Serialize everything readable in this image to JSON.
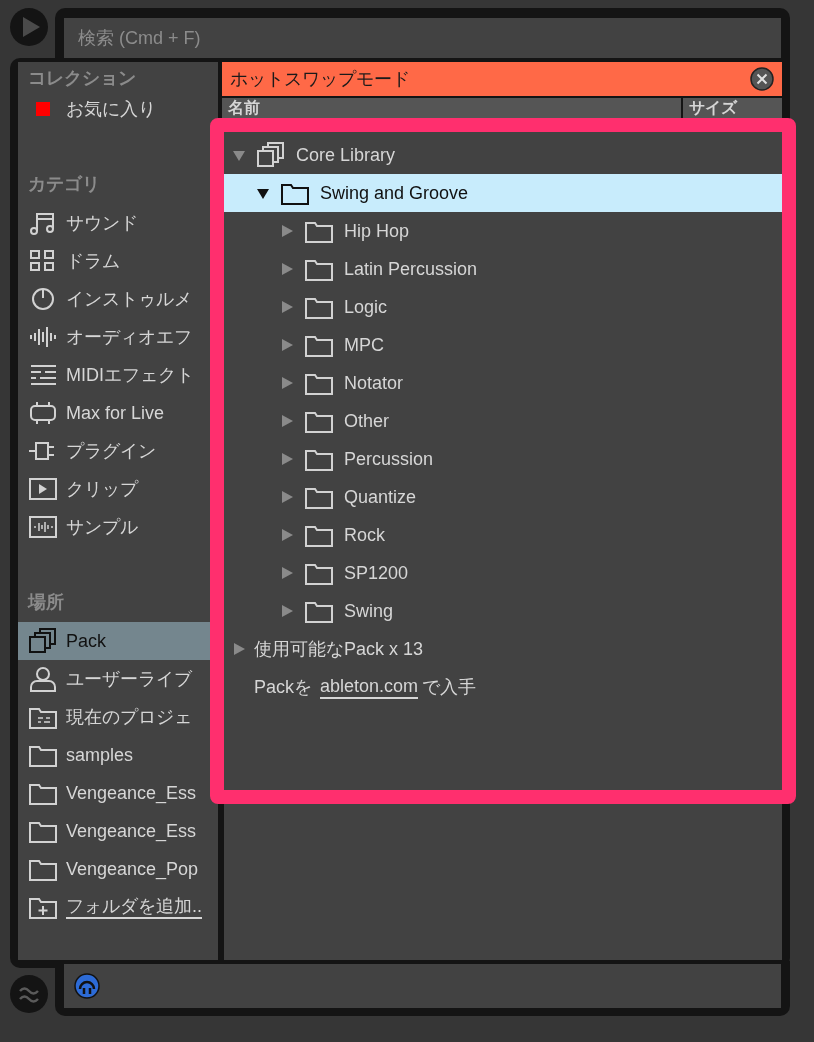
{
  "search": {
    "placeholder": "検索 (Cmd + F)"
  },
  "sidebar": {
    "sections": [
      {
        "title": "コレクション",
        "items": [
          {
            "label": "お気に入り",
            "color": "#ff0000",
            "selected": false
          }
        ]
      },
      {
        "title": "カテゴリ",
        "items": [
          {
            "label": "サウンド",
            "selected": false
          },
          {
            "label": "ドラム",
            "selected": false
          },
          {
            "label": "インストゥルメ",
            "selected": false
          },
          {
            "label": "オーディオエフ",
            "selected": false
          },
          {
            "label": "MIDIエフェクト",
            "selected": false
          },
          {
            "label": "Max for Live",
            "selected": false
          },
          {
            "label": "プラグイン",
            "selected": false
          },
          {
            "label": "クリップ",
            "selected": false
          },
          {
            "label": "サンプル",
            "selected": false
          }
        ]
      },
      {
        "title": "場所",
        "items": [
          {
            "label": "Pack",
            "selected": true
          },
          {
            "label": "ユーザーライブ",
            "selected": false
          },
          {
            "label": "現在のプロジェ",
            "selected": false
          },
          {
            "label": "samples",
            "selected": false
          },
          {
            "label": "Vengeance_Ess",
            "selected": false
          },
          {
            "label": "Vengeance_Ess",
            "selected": false
          },
          {
            "label": "Vengeance_Pop",
            "selected": false
          },
          {
            "label": "フォルダを追加..",
            "selected": false,
            "kind": "link"
          }
        ]
      }
    ]
  },
  "hotswap": {
    "label": "ホットスワップモード"
  },
  "columns": [
    "名前",
    "サイズ"
  ],
  "tree": [
    {
      "label": "Core Library",
      "kind": "pack",
      "expanded": true,
      "selected": false,
      "children": [
        {
          "label": "Swing and Groove",
          "kind": "folder",
          "expanded": true,
          "selected": true,
          "children": [
            {
              "label": "Hip Hop",
              "kind": "folder",
              "expanded": false,
              "selected": false
            },
            {
              "label": "Latin Percussion",
              "kind": "folder",
              "expanded": false,
              "selected": false
            },
            {
              "label": "Logic",
              "kind": "folder",
              "expanded": false,
              "selected": false
            },
            {
              "label": "MPC",
              "kind": "folder",
              "expanded": false,
              "selected": false
            },
            {
              "label": "Notator",
              "kind": "folder",
              "expanded": false,
              "selected": false
            },
            {
              "label": "Other",
              "kind": "folder",
              "expanded": false,
              "selected": false
            },
            {
              "label": "Percussion",
              "kind": "folder",
              "expanded": false,
              "selected": false
            },
            {
              "label": "Quantize",
              "kind": "folder",
              "expanded": false,
              "selected": false
            },
            {
              "label": "Rock",
              "kind": "folder",
              "expanded": false,
              "selected": false
            },
            {
              "label": "SP1200",
              "kind": "folder",
              "expanded": false,
              "selected": false
            },
            {
              "label": "Swing",
              "kind": "folder",
              "expanded": false,
              "selected": false
            }
          ]
        }
      ]
    },
    {
      "label": "使用可能なPack x 13",
      "kind": "group",
      "expanded": false,
      "selected": false
    }
  ],
  "get_packs": {
    "prefix": "Packを",
    "link": "ableton.com",
    "suffix": "で入手"
  }
}
